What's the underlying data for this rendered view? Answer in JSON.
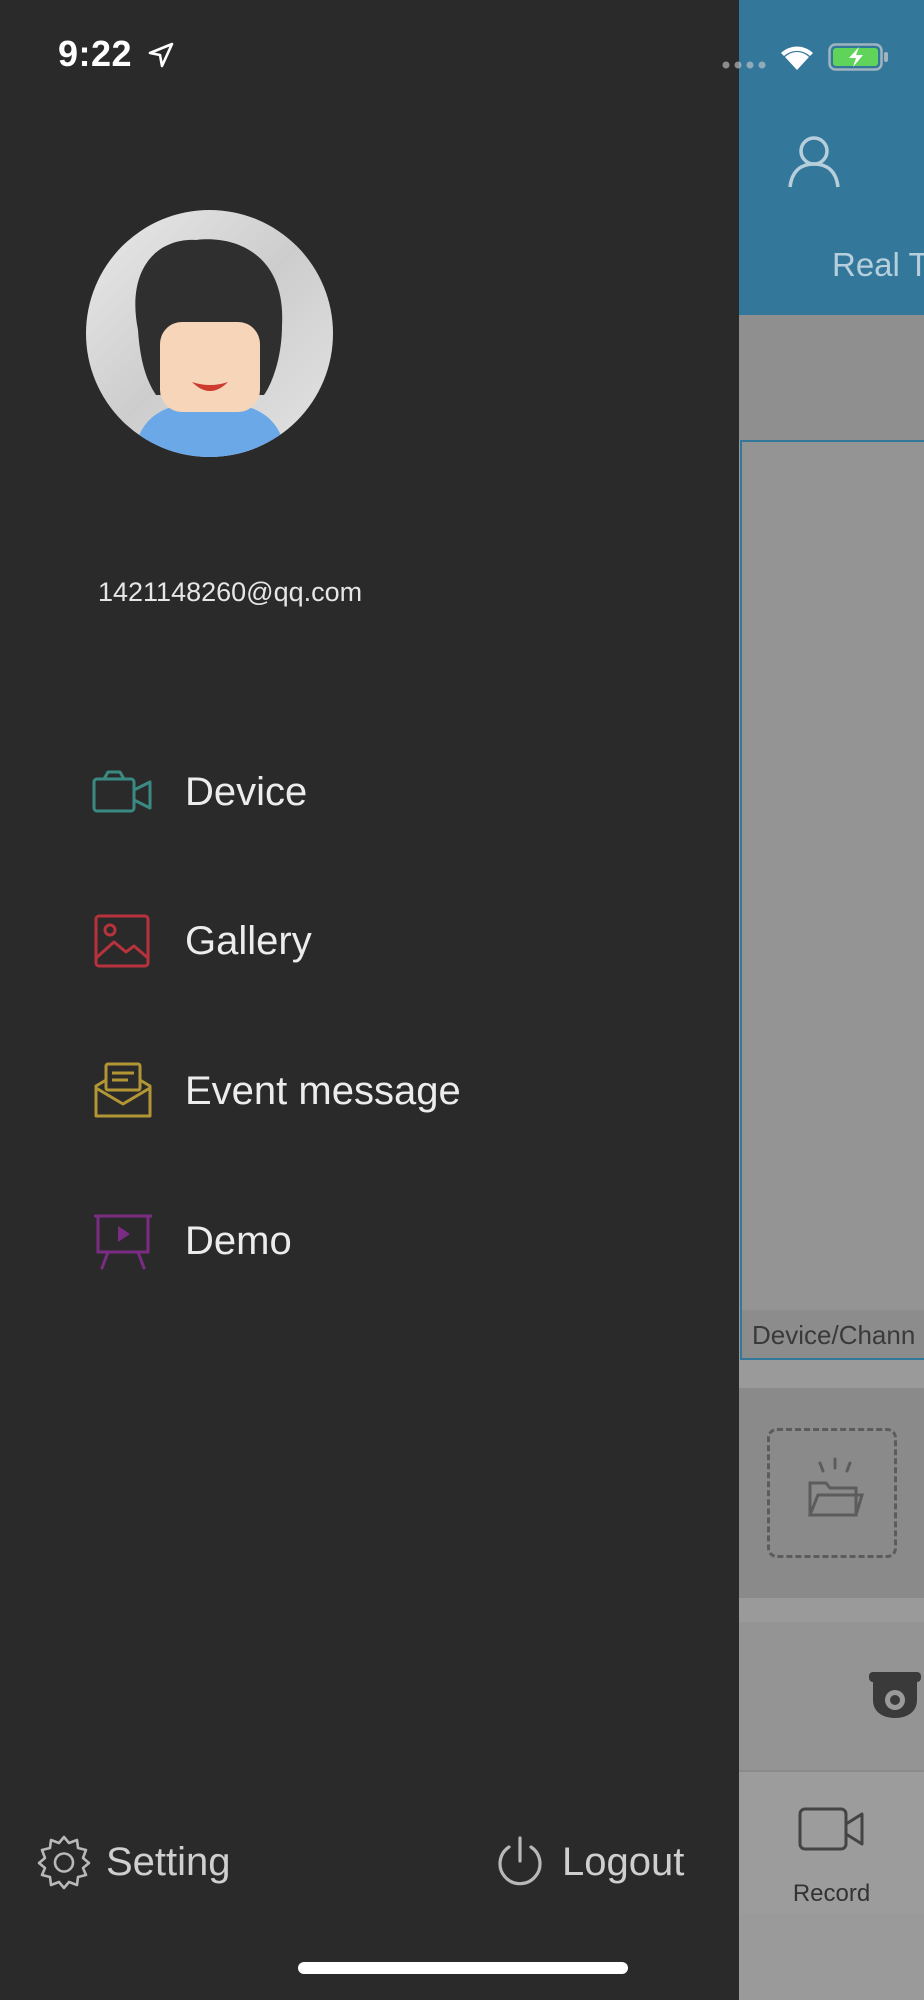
{
  "status_bar": {
    "time": "9:22"
  },
  "drawer": {
    "email": "1421148260@qq.com",
    "menu": [
      {
        "label": "Device",
        "icon": "video-camera-icon",
        "color": "#3a8a83"
      },
      {
        "label": "Gallery",
        "icon": "image-icon",
        "color": "#b8323c"
      },
      {
        "label": "Event message",
        "icon": "envelope-icon",
        "color": "#b39634"
      },
      {
        "label": "Demo",
        "icon": "presentation-icon",
        "color": "#7a2c82"
      }
    ],
    "setting_label": "Setting",
    "logout_label": "Logout"
  },
  "background_app": {
    "header_color": "#33779a",
    "tab_label": "Real T",
    "channel_label": "Device/Chann",
    "record_label": "Record"
  }
}
